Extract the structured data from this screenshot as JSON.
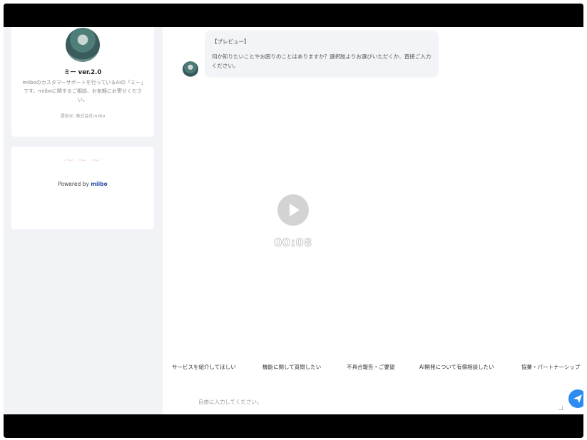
{
  "sidebar": {
    "bot_name": "ミー ver.2.0",
    "bot_description": "miiboのカスタマーサポートを行っているAIの「ミー」です。miiboに関するご相談、お気軽にお寄せください。",
    "provider": "提供元: 株式会社miibo",
    "powered_prefix": "Powered by ",
    "powered_brand": "miibo"
  },
  "chat": {
    "message": {
      "title": "【プレビュー】",
      "text": "何か知りたいことやお困りのことはありますか？選択肢よりお選びいただくか、直接ご入力ください。"
    },
    "video": {
      "timer": "00:08"
    },
    "choices": [
      "サービスを紹介してほしい",
      "機能に関して質問したい",
      "不具合報告・ご要望",
      "AI開発について有償相談したい",
      "協業・パートナーシップ"
    ],
    "input": {
      "placeholder": "自由に入力してください。",
      "value": ""
    }
  },
  "colors": {
    "accent": "#2d8cf0",
    "sidebar_bg": "#f1f3f7",
    "bubble_bg": "#f3f4f7",
    "brand": "#2b4ea6"
  },
  "icons": {
    "avatar": "bot-avatar-icon",
    "play": "play-icon",
    "send": "send-icon"
  }
}
